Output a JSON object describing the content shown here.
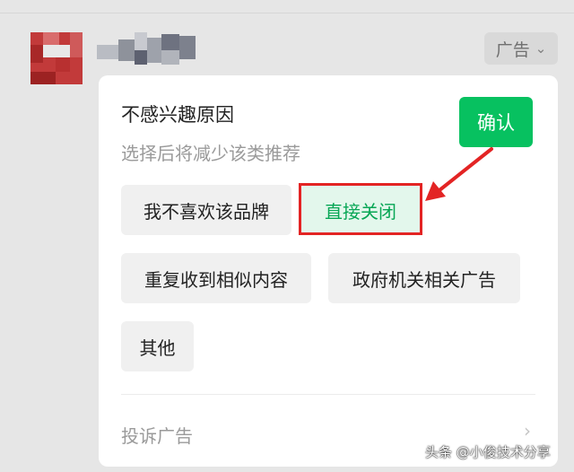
{
  "ad_tag": {
    "label": "广告",
    "icon": "chevron-down-icon"
  },
  "dialog": {
    "title": "不感兴趣原因",
    "subtitle": "选择后将减少该类推荐",
    "confirm_label": "确认",
    "reasons": [
      {
        "label": "我不喜欢该品牌",
        "selected": false
      },
      {
        "label": "直接关闭",
        "selected": true
      },
      {
        "label": "重复收到相似内容",
        "selected": false
      },
      {
        "label": "政府机关相关广告",
        "selected": false
      },
      {
        "label": "其他",
        "selected": false
      }
    ],
    "complaint_label": "投诉广告"
  },
  "watermark": "头条 @小俊技术分享",
  "colors": {
    "accent_green": "#07c160",
    "annotation_red": "#e32424",
    "overlay_gray": "#e6e6e6"
  }
}
